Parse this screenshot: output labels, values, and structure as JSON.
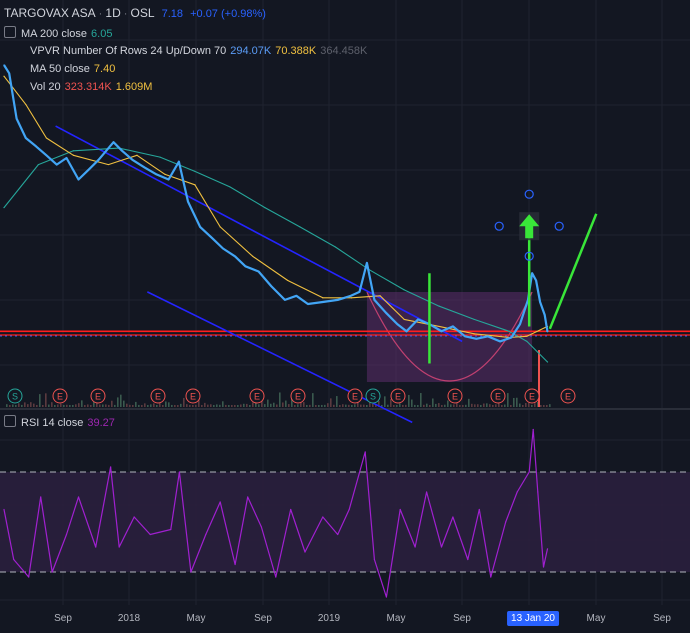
{
  "header": {
    "symbol": "TARGOVAX ASA",
    "interval": "1D",
    "exchange": "OSL",
    "last": "7.18",
    "change": "+0.07 (+0.98%)"
  },
  "indicators": {
    "ma200": {
      "label": "MA 200 close",
      "value": "6.05",
      "color": "#26a69a"
    },
    "vpvr": {
      "label": "VPVR Number Of Rows 24 Up/Down 70",
      "up": "294.07K",
      "down": "70.388K",
      "total": "364.458K"
    },
    "ma50": {
      "label": "MA 50 close",
      "value": "7.40",
      "color": "#f0c040"
    },
    "vol": {
      "label": "Vol 20",
      "v1": "323.314K",
      "v2": "1.609M"
    },
    "rsi": {
      "label": "RSI 14 close",
      "value": "39.27",
      "color": "#9c27b0"
    }
  },
  "x_axis": {
    "ticks": [
      "Sep",
      "2018",
      "May",
      "Sep",
      "2019",
      "May",
      "Sep",
      "May",
      "Sep"
    ],
    "highlight": "13 Jan 20"
  },
  "event_markers": [
    "S",
    "E",
    "E",
    "E",
    "E",
    "E",
    "E",
    "E",
    "S",
    "E",
    "E",
    "E",
    "E",
    "E"
  ],
  "chart_data": {
    "type": "line",
    "title": "TARGOVAX ASA · 1D · OSL",
    "x_unit": "date",
    "x_range": [
      "2017-07-03",
      "2020-10-01"
    ],
    "series": [
      {
        "name": "TARGOVAX ASA close",
        "points": [
          [
            "2017-07-03",
            32.5
          ],
          [
            "2017-07-12",
            31.0
          ],
          [
            "2017-07-25",
            24.0
          ],
          [
            "2017-08-10",
            21.5
          ],
          [
            "2017-08-28",
            20.5
          ],
          [
            "2017-09-15",
            19.5
          ],
          [
            "2017-10-03",
            18.5
          ],
          [
            "2017-10-20",
            19.2
          ],
          [
            "2017-11-10",
            17.0
          ],
          [
            "2017-11-28",
            18.0
          ],
          [
            "2017-12-15",
            19.0
          ],
          [
            "2018-01-10",
            21.0
          ],
          [
            "2018-01-25",
            20.0
          ],
          [
            "2018-02-12",
            19.0
          ],
          [
            "2018-03-05",
            18.2
          ],
          [
            "2018-03-26",
            17.5
          ],
          [
            "2018-04-16",
            17.0
          ],
          [
            "2018-05-04",
            18.8
          ],
          [
            "2018-05-20",
            15.0
          ],
          [
            "2018-06-10",
            13.0
          ],
          [
            "2018-07-01",
            12.2
          ],
          [
            "2018-07-20",
            11.5
          ],
          [
            "2018-08-10",
            11.0
          ],
          [
            "2018-08-28",
            10.4
          ],
          [
            "2018-09-20",
            10.1
          ],
          [
            "2018-10-12",
            9.3
          ],
          [
            "2018-11-05",
            8.6
          ],
          [
            "2018-11-25",
            8.8
          ],
          [
            "2018-12-15",
            8.4
          ],
          [
            "2019-01-10",
            8.5
          ],
          [
            "2019-02-05",
            8.6
          ],
          [
            "2019-02-28",
            8.8
          ],
          [
            "2019-03-15",
            9.0
          ],
          [
            "2019-03-28",
            10.6
          ],
          [
            "2019-04-10",
            8.6
          ],
          [
            "2019-04-30",
            8.0
          ],
          [
            "2019-05-20",
            7.5
          ],
          [
            "2019-06-05",
            7.2
          ],
          [
            "2019-06-25",
            7.7
          ],
          [
            "2019-07-15",
            7.5
          ],
          [
            "2019-08-05",
            7.2
          ],
          [
            "2019-08-25",
            7.4
          ],
          [
            "2019-09-15",
            7.0
          ],
          [
            "2019-10-05",
            6.9
          ],
          [
            "2019-10-25",
            7.0
          ],
          [
            "2019-11-15",
            6.8
          ],
          [
            "2019-12-05",
            6.95
          ],
          [
            "2019-12-20",
            7.5
          ],
          [
            "2020-01-03",
            8.6
          ],
          [
            "2020-01-10",
            10.0
          ],
          [
            "2020-01-17",
            9.6
          ],
          [
            "2020-01-24",
            8.5
          ],
          [
            "2020-02-01",
            7.9
          ],
          [
            "2020-02-06",
            7.18
          ]
        ]
      },
      {
        "name": "MA 50 close",
        "color": "#f0c040",
        "points": [
          [
            "2017-07-03",
            30.5
          ],
          [
            "2017-08-10",
            26.0
          ],
          [
            "2017-09-15",
            21.5
          ],
          [
            "2017-11-01",
            19.5
          ],
          [
            "2018-01-01",
            18.5
          ],
          [
            "2018-02-20",
            19.5
          ],
          [
            "2018-04-10",
            17.5
          ],
          [
            "2018-06-01",
            16.5
          ],
          [
            "2018-07-15",
            13.0
          ],
          [
            "2018-09-10",
            11.0
          ],
          [
            "2018-11-10",
            9.6
          ],
          [
            "2019-01-10",
            8.7
          ],
          [
            "2019-03-01",
            8.7
          ],
          [
            "2019-04-20",
            8.8
          ],
          [
            "2019-06-01",
            7.7
          ],
          [
            "2019-08-01",
            7.4
          ],
          [
            "2019-10-01",
            7.1
          ],
          [
            "2019-12-01",
            6.95
          ],
          [
            "2020-01-01",
            7.0
          ],
          [
            "2020-02-06",
            7.4
          ]
        ]
      },
      {
        "name": "MA 200 close",
        "color": "#26a69a",
        "points": [
          [
            "2017-07-03",
            14.5
          ],
          [
            "2017-09-01",
            18.5
          ],
          [
            "2017-11-01",
            20.0
          ],
          [
            "2018-01-20",
            20.3
          ],
          [
            "2018-04-01",
            19.3
          ],
          [
            "2018-06-01",
            17.8
          ],
          [
            "2018-08-01",
            16.3
          ],
          [
            "2018-10-01",
            14.5
          ],
          [
            "2018-12-01",
            13.0
          ],
          [
            "2019-02-01",
            11.6
          ],
          [
            "2019-04-01",
            10.2
          ],
          [
            "2019-06-01",
            9.1
          ],
          [
            "2019-08-01",
            8.3
          ],
          [
            "2019-10-01",
            7.7
          ],
          [
            "2019-12-01",
            7.2
          ],
          [
            "2020-01-01",
            6.8
          ],
          [
            "2020-02-06",
            6.05
          ]
        ]
      },
      {
        "name": "RSI 14 close",
        "color": "#9c27b0",
        "points": [
          [
            "2017-07-03",
            55
          ],
          [
            "2017-07-20",
            35
          ],
          [
            "2017-08-15",
            28
          ],
          [
            "2017-09-05",
            60
          ],
          [
            "2017-09-25",
            30
          ],
          [
            "2017-10-20",
            45
          ],
          [
            "2017-11-10",
            60
          ],
          [
            "2017-12-10",
            40
          ],
          [
            "2018-01-05",
            72
          ],
          [
            "2018-01-20",
            40
          ],
          [
            "2018-02-15",
            52
          ],
          [
            "2018-03-15",
            45
          ],
          [
            "2018-04-20",
            47
          ],
          [
            "2018-05-05",
            70
          ],
          [
            "2018-05-25",
            30
          ],
          [
            "2018-06-20",
            45
          ],
          [
            "2018-07-15",
            58
          ],
          [
            "2018-08-10",
            33
          ],
          [
            "2018-09-01",
            60
          ],
          [
            "2018-09-25",
            48
          ],
          [
            "2018-10-20",
            28
          ],
          [
            "2018-11-15",
            55
          ],
          [
            "2018-12-10",
            38
          ],
          [
            "2019-01-10",
            52
          ],
          [
            "2019-02-05",
            45
          ],
          [
            "2019-02-25",
            55
          ],
          [
            "2019-03-25",
            78
          ],
          [
            "2019-04-10",
            35
          ],
          [
            "2019-05-01",
            20
          ],
          [
            "2019-05-25",
            55
          ],
          [
            "2019-06-20",
            40
          ],
          [
            "2019-07-10",
            62
          ],
          [
            "2019-08-05",
            40
          ],
          [
            "2019-08-25",
            52
          ],
          [
            "2019-09-20",
            35
          ],
          [
            "2019-10-10",
            55
          ],
          [
            "2019-10-30",
            28
          ],
          [
            "2019-11-25",
            50
          ],
          [
            "2019-12-15",
            62
          ],
          [
            "2020-01-05",
            70
          ],
          [
            "2020-01-12",
            87
          ],
          [
            "2020-01-20",
            62
          ],
          [
            "2020-01-30",
            32
          ],
          [
            "2020-02-06",
            39.27
          ]
        ]
      }
    ],
    "drawings": [
      {
        "kind": "horizontal-line",
        "color": "#ff1e1e",
        "y": 7.2
      },
      {
        "kind": "horizontal-line",
        "color": "#ff1e1e",
        "y": 7.05
      },
      {
        "kind": "trendline",
        "color": "#2424ff",
        "from": [
          "2017-10-01",
          23.0
        ],
        "to": [
          "2019-09-10",
          6.8
        ]
      },
      {
        "kind": "trendline",
        "color": "#2424ff",
        "from": [
          "2018-03-10",
          9.0
        ],
        "to": [
          "2019-06-15",
          4.3
        ]
      },
      {
        "kind": "cup-shape",
        "color": "#6a2c70",
        "from": "2019-03-28",
        "to": "2020-01-10"
      },
      {
        "kind": "vertical-segment",
        "color": "#39e639",
        "x": "2019-07-15",
        "from": 10.0,
        "to": 6.0
      },
      {
        "kind": "vertical-segment",
        "color": "#39e639",
        "x": "2020-01-05",
        "from": 7.4,
        "to": 12.4
      },
      {
        "kind": "arrow-up",
        "color": "#39e639",
        "x": "2020-01-05",
        "y": 13.2
      },
      {
        "kind": "projection",
        "color": "#39e639",
        "from": [
          "2020-02-10",
          7.3
        ],
        "to": [
          "2020-05-01",
          14.0
        ]
      }
    ],
    "rsi_levels": [
      70,
      30
    ],
    "rsi_range": [
      0,
      100
    ],
    "grid": true,
    "legend_position": "top-left"
  }
}
